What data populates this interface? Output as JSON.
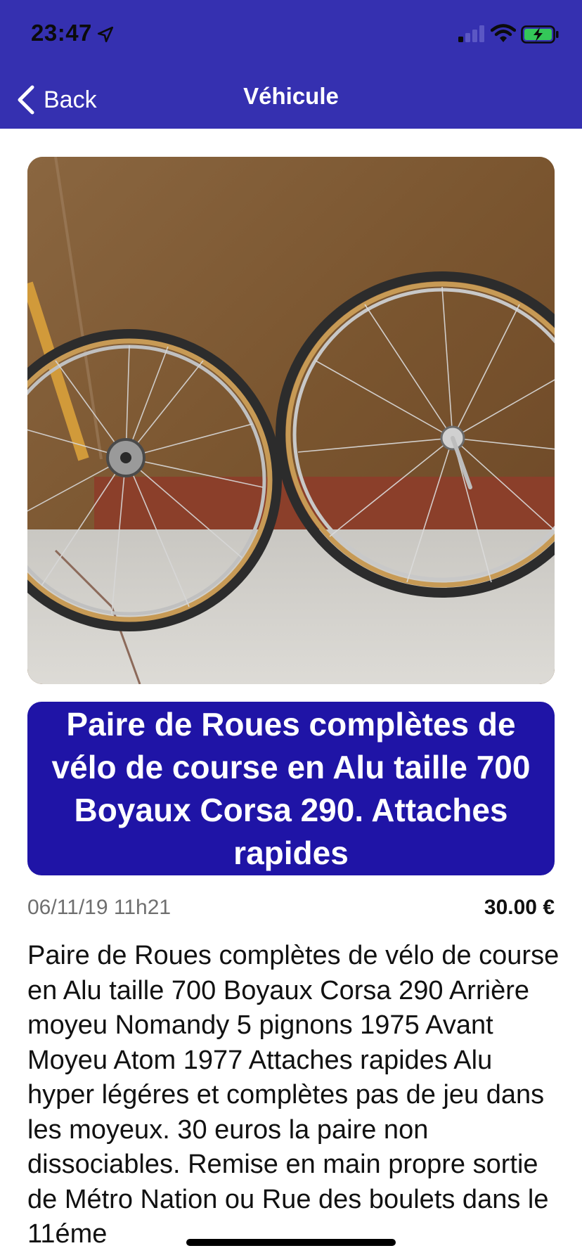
{
  "status_bar": {
    "time": "23:47",
    "icons": [
      "location-arrow-icon",
      "cellular-signal-icon",
      "wifi-icon",
      "battery-charging-icon"
    ]
  },
  "nav": {
    "back_label": "Back",
    "title": "Véhicule"
  },
  "listing": {
    "image_icon": "bicycle-wheels-photo",
    "title": "Paire de Roues complètes de vélo de course en Alu taille 700 Boyaux Corsa 290. Attaches rapides",
    "date": "06/11/19 11h21",
    "price": "30.00 €",
    "description": "Paire de Roues complètes de vélo de course en Alu taille 700 Boyaux Corsa 290 Arrière moyeu Nomandy 5 pignons 1975 Avant Moyeu Atom 1977 Attaches rapides Alu hyper légéres et complètes pas de jeu dans les moyeux. 30 euros la paire non dissociables. Remise en main propre sortie de Métro Nation ou Rue des boulets dans le 11éme"
  },
  "colors": {
    "header": "#3530b0",
    "title_box": "#1f14a6",
    "battery": "#34c759"
  }
}
